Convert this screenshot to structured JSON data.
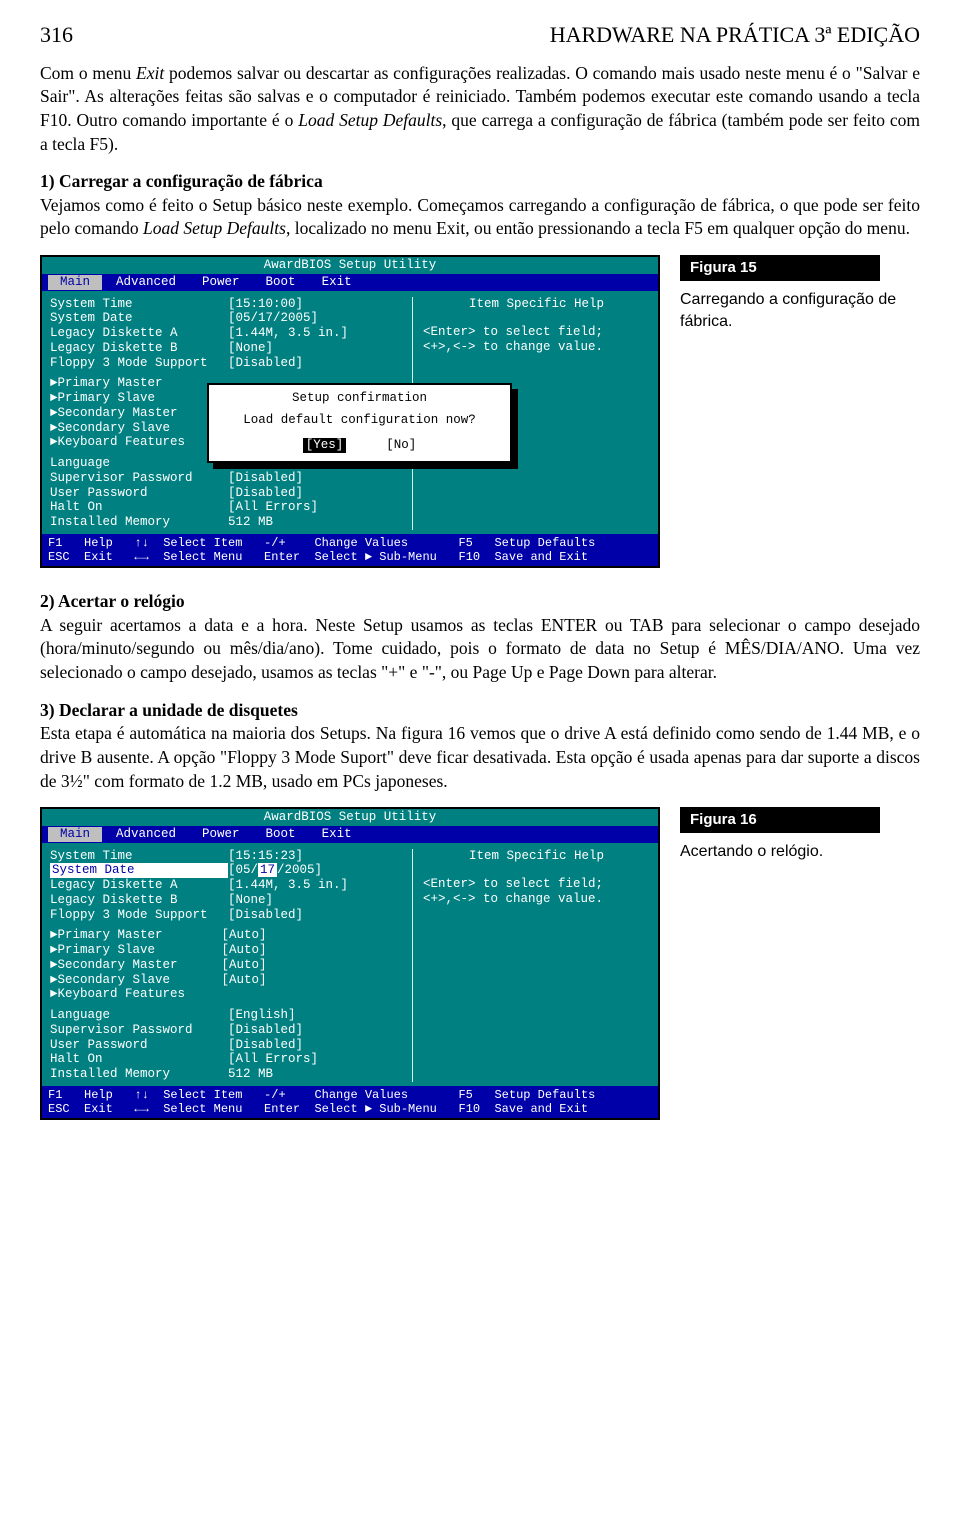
{
  "page_number": "316",
  "header_title": "HARDWARE NA PRÁTICA 3ª EDIÇÃO",
  "intro_p1": "Com o menu ",
  "intro_exit": "Exit",
  "intro_p1b": " podemos salvar ou descartar as configurações realizadas. O comando mais usado neste menu é o \"Salvar e Sair\". As alterações feitas são salvas e o computador é reiniciado. Também podemos executar este comando usando a tecla F10. Outro comando importante é o ",
  "intro_lsd": "Load Setup Defaults",
  "intro_p1c": ", que carrega a configuração de fábrica (também pode ser feito com a tecla F5).",
  "sec1_title": "1) Carregar a configuração de fábrica",
  "sec1_p1a": "Vejamos como é feito o Setup básico neste exemplo. Começamos carregando a configuração de fábrica, o que pode ser feito pelo comando ",
  "sec1_lsd": "Load Setup Defaults",
  "sec1_p1b": ", localizado no menu Exit, ou então pressionando a tecla F5 em qualquer opção do menu.",
  "fig15_label": "Figura 15",
  "fig15_caption": "Carregando a configuração de fábrica.",
  "bios_title": "AwardBIOS Setup Utility",
  "menu": {
    "main": "Main",
    "advanced": "Advanced",
    "power": "Power",
    "boot": "Boot",
    "exit": "Exit"
  },
  "help_title": "Item Specific Help",
  "help_l1": "<Enter> to select field;",
  "help_l2": "<+>,<-> to change value.",
  "bios1": {
    "system_time_lbl": "System Time",
    "system_time_val": "[15:10:00]",
    "system_date_lbl": "System Date",
    "system_date_val": "[05/17/2005]",
    "diskette_a_lbl": "Legacy Diskette A",
    "diskette_a_val": "[1.44M, 3.5 in.]",
    "diskette_b_lbl": "Legacy Diskette B",
    "diskette_b_val": "[None]",
    "floppy3_lbl": "Floppy 3 Mode Support",
    "floppy3_val": "[Disabled]",
    "pm": "Primary Master",
    "ps": "Primary Slave",
    "sm": "Secondary Master",
    "ss": "Secondary Slave",
    "kb": "Keyboard Features",
    "lang_lbl": "Language",
    "sup_lbl": "Supervisor Password",
    "sup_val": "[Disabled]",
    "usr_lbl": "User Password",
    "usr_val": "[Disabled]",
    "halt_lbl": "Halt On",
    "halt_val": "[All Errors]",
    "mem_lbl": "Installed Memory",
    "mem_val": "512 MB"
  },
  "dialog": {
    "title": "Setup confirmation",
    "msg": "Load default configuration now?",
    "yes": "[Yes]",
    "no": "[No]"
  },
  "footer_l1": "F1   Help   ↑↓  Select Item   -/+    Change Values       F5   Setup Defaults",
  "footer_l2": "ESC  Exit   ←→  Select Menu   Enter  Select ► Sub-Menu   F10  Save and Exit",
  "sec2_title": "2) Acertar o relógio",
  "sec2_p": "A seguir acertamos a data e a hora. Neste Setup usamos as teclas ENTER ou TAB para selecionar o campo desejado (hora/minuto/segundo ou mês/dia/ano). Tome cuidado, pois o formato de data no Setup é MÊS/DIA/ANO. Uma vez selecionado o campo desejado, usamos as teclas \"+\" e \"-\", ou Page Up e Page Down para alterar.",
  "sec3_title": "3) Declarar a unidade de disquetes",
  "sec3_p": "Esta etapa é automática na maioria dos Setups. Na figura 16 vemos que o drive A está definido como sendo de 1.44 MB, e o drive B ausente. A opção \"Floppy 3 Mode Suport\" deve ficar desativada. Esta opção é usada apenas para dar suporte a discos de 3½\" com formato de 1.2 MB, usado em PCs japoneses.",
  "fig16_label": "Figura 16",
  "fig16_caption": "Acertando o relógio.",
  "bios2": {
    "system_time_lbl": "System Time",
    "system_time_val": "[15:15:23]",
    "system_date_lbl": "System Date",
    "system_date_val_a": "[05/",
    "system_date_val_hl": "17",
    "system_date_val_b": "/2005]",
    "diskette_a_lbl": "Legacy Diskette A",
    "diskette_a_val": "[1.44M, 3.5 in.]",
    "diskette_b_lbl": "Legacy Diskette B",
    "diskette_b_val": "[None]",
    "floppy3_lbl": "Floppy 3 Mode Support",
    "floppy3_val": "[Disabled]",
    "pm": "Primary Master",
    "pm_v": "[Auto]",
    "ps": "Primary Slave",
    "ps_v": "[Auto]",
    "sm": "Secondary Master",
    "sm_v": "[Auto]",
    "ss": "Secondary Slave",
    "ss_v": "[Auto]",
    "kb": "Keyboard Features",
    "lang_lbl": "Language",
    "lang_val": "[English]",
    "sup_lbl": "Supervisor Password",
    "sup_val": "[Disabled]",
    "usr_lbl": "User Password",
    "usr_val": "[Disabled]",
    "halt_lbl": "Halt On",
    "halt_val": "[All Errors]",
    "mem_lbl": "Installed Memory",
    "mem_val": "512 MB"
  }
}
